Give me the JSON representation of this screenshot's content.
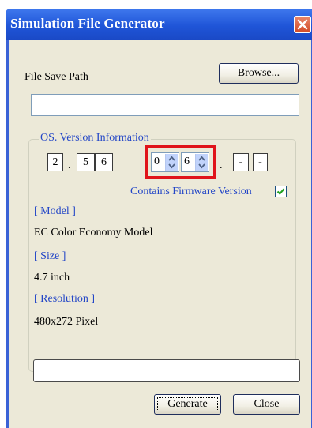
{
  "window": {
    "title": "Simulation File Generator"
  },
  "save_path": {
    "label": "File Save Path",
    "browse_label": "Browse...",
    "value": ""
  },
  "os_version": {
    "group_title": "OS. Version Information",
    "fixed_digits": [
      "2",
      "5",
      "6"
    ],
    "spinners": [
      "0",
      "6"
    ],
    "trailing_digits": [
      "-",
      "-"
    ],
    "firmware_label": "Contains Firmware Version",
    "firmware_checked": true
  },
  "model": {
    "header": "[ Model ]",
    "value": "EC Color Economy Model"
  },
  "size": {
    "header": "[ Size ]",
    "value": "4.7 inch"
  },
  "resolution": {
    "header": "[ Resolution ]",
    "value": "480x272 Pixel"
  },
  "status": {
    "value": ""
  },
  "buttons": {
    "generate": "Generate",
    "close": "Close"
  },
  "colors": {
    "title_bar": "#2459dc",
    "accent_text": "#2346c7",
    "highlight": "#e0141b",
    "client_bg": "#ece9d8"
  }
}
